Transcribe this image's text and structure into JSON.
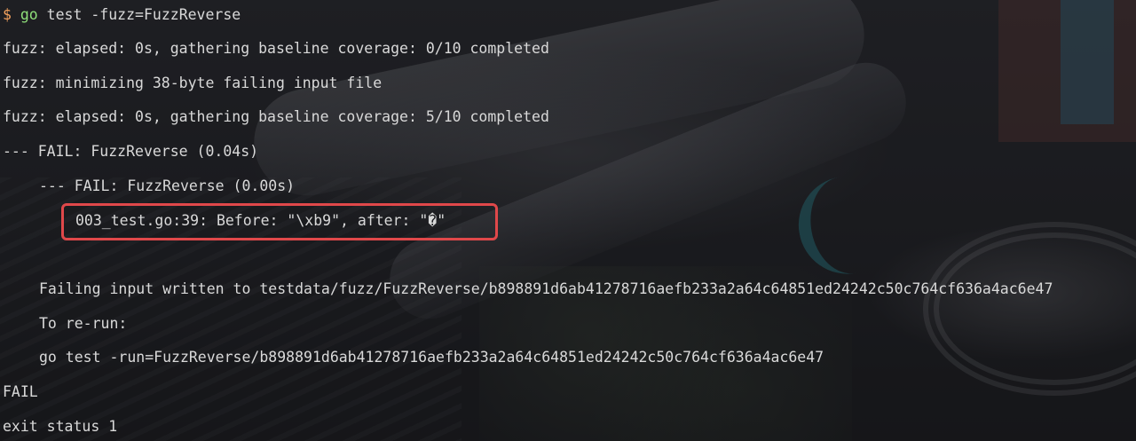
{
  "terminal": {
    "prompt_symbol": "$",
    "command_program": "go",
    "command_args": " test -fuzz=FuzzReverse",
    "lines": [
      "fuzz: elapsed: 0s, gathering baseline coverage: 0/10 completed",
      "fuzz: minimizing 38-byte failing input file",
      "fuzz: elapsed: 0s, gathering baseline coverage: 5/10 completed",
      "--- FAIL: FuzzReverse (0.04s)",
      "--- FAIL: FuzzReverse (0.00s)",
      "003_test.go:39: Before: \"\\xb9\", after: \"�\"",
      "Failing input written to testdata/fuzz/FuzzReverse/b898891d6ab41278716aefb233a2a64c64851ed24242c50c764cf636a4ac6e47",
      "To re-run:",
      "go test -run=FuzzReverse/b898891d6ab41278716aefb233a2a64c64851ed24242c50c764cf636a4ac6e47",
      "FAIL",
      "exit status 1"
    ]
  },
  "colors": {
    "prompt": "#f5a25d",
    "command_program": "#8fe07a",
    "text": "#d9d9d9",
    "highlight_border": "#e0484a"
  }
}
